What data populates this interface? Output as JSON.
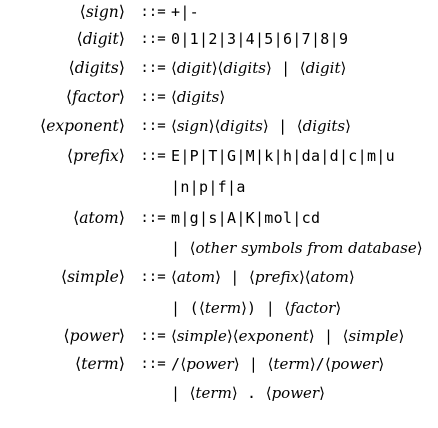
{
  "rules": [
    {
      "lhs": "sign",
      "op": "::=",
      "rhs": [
        {
          "t": "lit",
          "v": "+|-"
        }
      ]
    },
    {
      "lhs": "digit",
      "op": "::=",
      "rhs": [
        {
          "t": "lit",
          "v": "0|1|2|3|4|5|6|7|8|9"
        }
      ]
    },
    {
      "lhs": "digits",
      "op": "::=",
      "rhs": [
        {
          "t": "nt",
          "v": "digit"
        },
        {
          "t": "nt",
          "v": "digits"
        },
        {
          "t": "lit",
          "v": " | "
        },
        {
          "t": "nt",
          "v": "digit"
        }
      ]
    },
    {
      "lhs": "factor",
      "op": "::=",
      "rhs": [
        {
          "t": "nt",
          "v": "digits"
        }
      ]
    },
    {
      "lhs": "exponent",
      "op": "::=",
      "rhs": [
        {
          "t": "nt",
          "v": "sign"
        },
        {
          "t": "nt",
          "v": "digits"
        },
        {
          "t": "lit",
          "v": " | "
        },
        {
          "t": "nt",
          "v": "digits"
        }
      ]
    },
    {
      "lhs": "prefix",
      "op": "::=",
      "rhs": [
        {
          "t": "lit",
          "v": "E|P|T|G|M|k|h|da|d|c|m|u"
        }
      ]
    },
    {
      "lhs": "",
      "op": "",
      "rhs": [
        {
          "t": "lit",
          "v": "|n|p|f|a"
        }
      ]
    },
    {
      "lhs": "atom",
      "op": "::=",
      "rhs": [
        {
          "t": "lit",
          "v": "m|g|s|A|K|mol|cd"
        }
      ]
    },
    {
      "lhs": "",
      "op": "",
      "rhs": [
        {
          "t": "lit",
          "v": "| "
        },
        {
          "t": "nt",
          "v": "other symbols from database"
        }
      ]
    },
    {
      "lhs": "simple",
      "op": "::=",
      "rhs": [
        {
          "t": "nt",
          "v": "atom"
        },
        {
          "t": "lit",
          "v": " | "
        },
        {
          "t": "nt",
          "v": "prefix"
        },
        {
          "t": "nt",
          "v": "atom"
        }
      ]
    },
    {
      "lhs": "",
      "op": "",
      "rhs": [
        {
          "t": "lit",
          "v": "| ("
        },
        {
          "t": "nt",
          "v": "term"
        },
        {
          "t": "lit",
          "v": ") | "
        },
        {
          "t": "nt",
          "v": "factor"
        }
      ]
    },
    {
      "lhs": "power",
      "op": "::=",
      "rhs": [
        {
          "t": "nt",
          "v": "simple"
        },
        {
          "t": "nt",
          "v": "exponent"
        },
        {
          "t": "lit",
          "v": " | "
        },
        {
          "t": "nt",
          "v": "simple"
        }
      ]
    },
    {
      "lhs": "term",
      "op": "::=",
      "rhs": [
        {
          "t": "lit",
          "v": "/"
        },
        {
          "t": "nt",
          "v": "power"
        },
        {
          "t": "lit",
          "v": " | "
        },
        {
          "t": "nt",
          "v": "term"
        },
        {
          "t": "lit",
          "v": "/"
        },
        {
          "t": "nt",
          "v": "power"
        }
      ]
    },
    {
      "lhs": "",
      "op": "",
      "rhs": [
        {
          "t": "lit",
          "v": "| "
        },
        {
          "t": "nt",
          "v": "term"
        },
        {
          "t": "lit",
          "v": " . "
        },
        {
          "t": "nt",
          "v": "power"
        }
      ]
    }
  ]
}
